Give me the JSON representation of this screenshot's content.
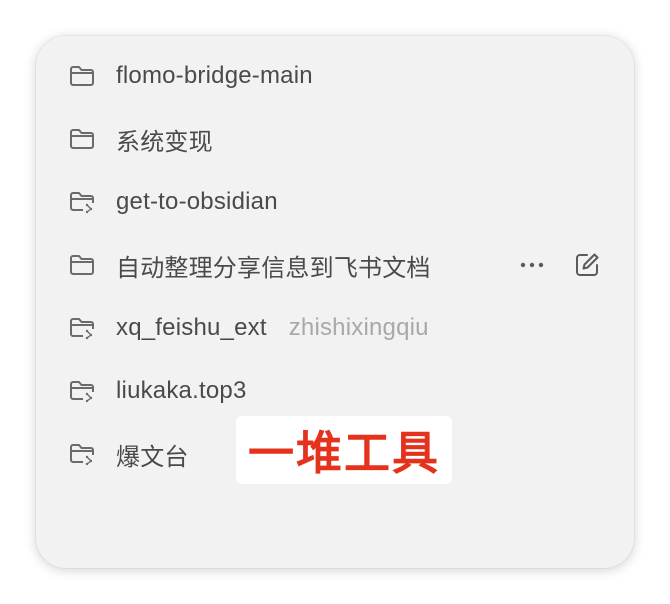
{
  "folders": [
    {
      "label": "flomo-bridge-main",
      "icon": "folder-icon"
    },
    {
      "label": "系统变现",
      "icon": "folder-icon"
    },
    {
      "label": "get-to-obsidian",
      "icon": "shared-folder-icon"
    },
    {
      "label": "自动整理分享信息到飞书文档",
      "icon": "folder-icon",
      "actions": [
        "more-icon",
        "edit-icon"
      ]
    },
    {
      "label": "xq_feishu_ext",
      "sub": "zhishixingqiu",
      "icon": "shared-folder-icon"
    },
    {
      "label": "liukaka.top3",
      "icon": "shared-folder-icon"
    },
    {
      "label": "爆文台",
      "icon": "shared-folder-icon"
    }
  ],
  "annotation": {
    "text": "一堆工具",
    "color": "#e5321d"
  }
}
